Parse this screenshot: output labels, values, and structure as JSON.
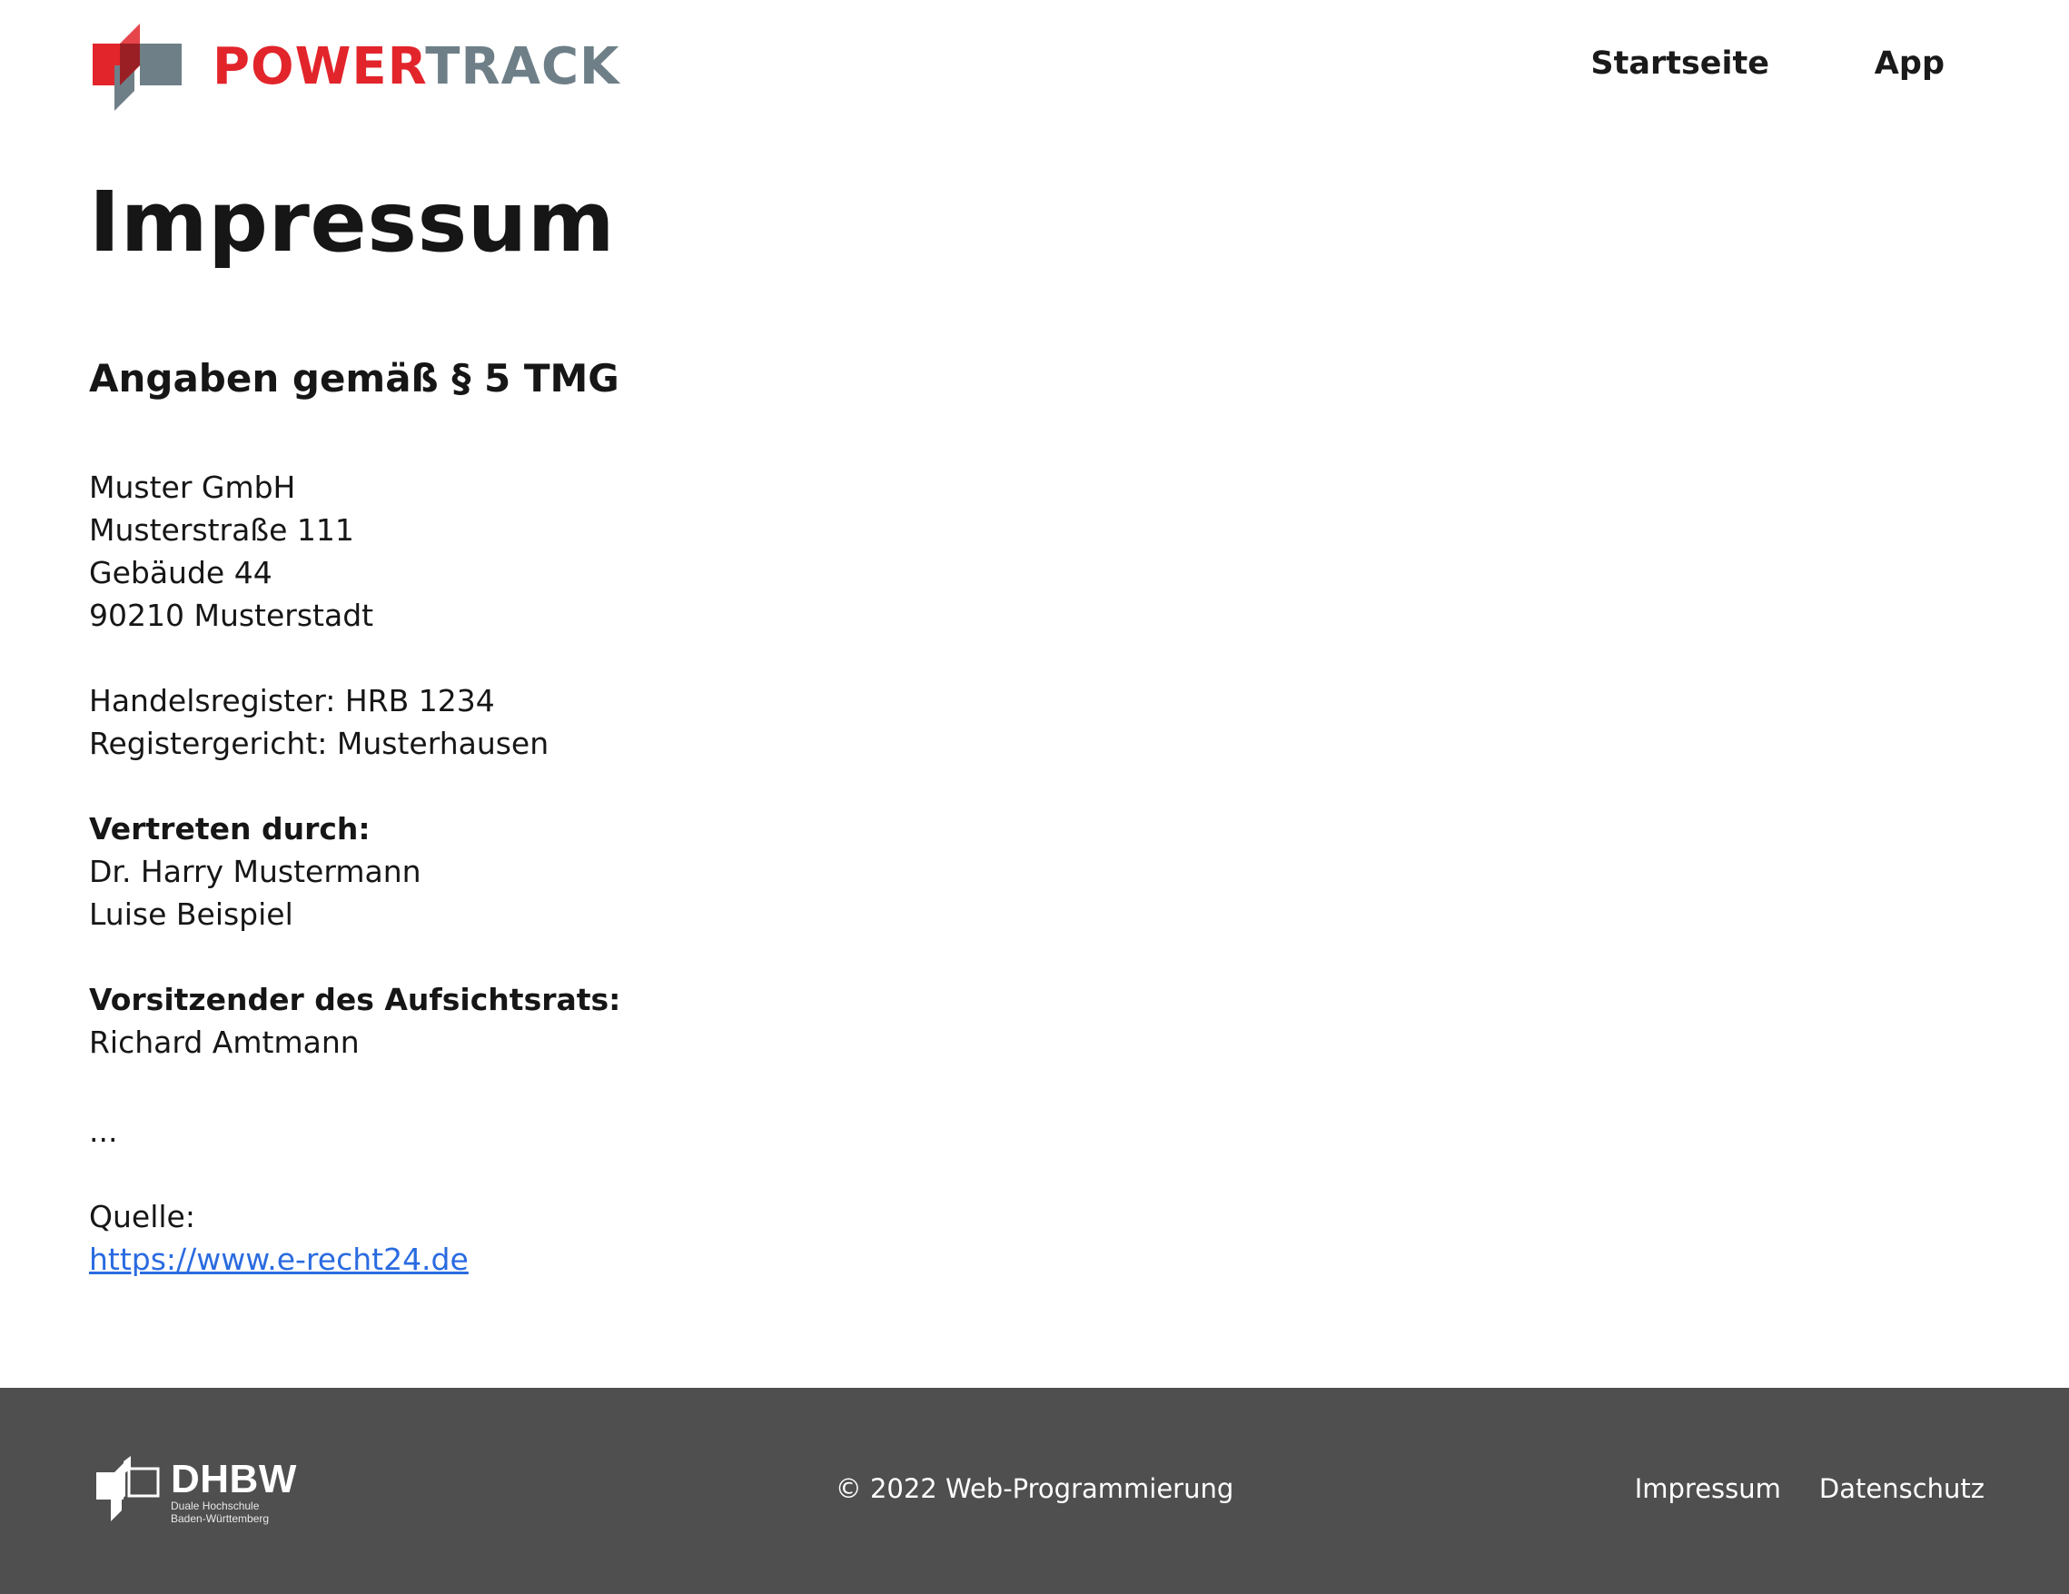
{
  "header": {
    "brand": {
      "part1": "POWER",
      "part2": "TRACK"
    },
    "nav": [
      {
        "label": "Startseite"
      },
      {
        "label": "App"
      }
    ]
  },
  "main": {
    "title": "Impressum",
    "section_title": "Angaben gemäß § 5 TMG",
    "address": [
      "Muster GmbH",
      "Musterstraße 111",
      "Gebäude 44",
      "90210 Musterstadt"
    ],
    "register": [
      "Handelsregister: HRB 1234",
      "Registergericht: Musterhausen"
    ],
    "represented_by_label": "Vertreten durch:",
    "represented_by": [
      "Dr. Harry Mustermann",
      "Luise Beispiel"
    ],
    "board_chair_label": "Vorsitzender des Aufsichtsrats:",
    "board_chair": "Richard Amtmann",
    "ellipsis": "...",
    "source_label": "Quelle:",
    "source_link": "https://www.e-recht24.de"
  },
  "footer": {
    "logo": {
      "name": "DHBW",
      "sub1": "Duale Hochschule",
      "sub2": "Baden-Württemberg"
    },
    "copyright": "© 2022 Web-Programmierung",
    "links": [
      {
        "label": "Impressum"
      },
      {
        "label": "Datenschutz"
      }
    ]
  },
  "colors": {
    "brand_red": "#e2242b",
    "brand_gray": "#6e7f88",
    "link_blue": "#2a6be0",
    "footer_bg": "#4f4f4f"
  }
}
